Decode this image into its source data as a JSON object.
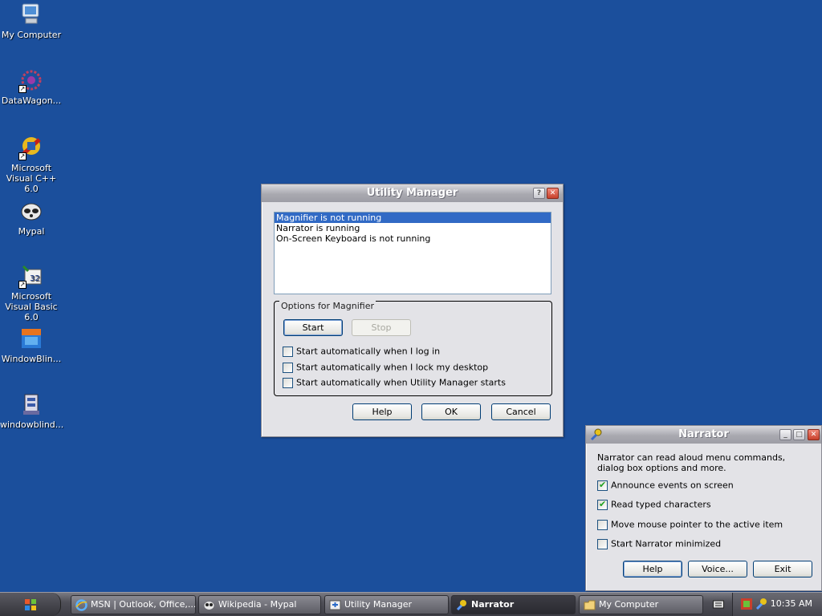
{
  "desktop": {
    "icons": [
      {
        "label": "My Computer",
        "icon": "my-computer-icon"
      },
      {
        "label": "DataWagon...",
        "icon": "datawagon-icon"
      },
      {
        "label": "Microsoft Visual C++ 6.0",
        "icon": "visual-cpp-icon"
      },
      {
        "label": "Mypal",
        "icon": "mypal-icon"
      },
      {
        "label": "Microsoft Visual Basic 6.0",
        "icon": "visual-basic-icon"
      },
      {
        "label": "WindowBlin...",
        "icon": "windowblinds-icon"
      },
      {
        "label": "windowblind...",
        "icon": "windowblinds-installer-icon"
      }
    ]
  },
  "utility_manager": {
    "title": "Utility Manager",
    "list": [
      "Magnifier is not running",
      "Narrator is running",
      "On-Screen Keyboard is not running"
    ],
    "selected_index": 0,
    "group_label": "Options for Magnifier",
    "start_label": "Start",
    "stop_label": "Stop",
    "options": [
      {
        "label": "Start automatically when I log in",
        "checked": false
      },
      {
        "label": "Start automatically when I lock my desktop",
        "checked": false
      },
      {
        "label": "Start automatically when Utility Manager starts",
        "checked": false
      }
    ],
    "help_label": "Help",
    "ok_label": "OK",
    "cancel_label": "Cancel"
  },
  "narrator": {
    "title": "Narrator",
    "description": "Narrator can read aloud menu commands, dialog box options and more.",
    "options": [
      {
        "label": "Announce events on screen",
        "checked": true
      },
      {
        "label": "Read typed characters",
        "checked": true
      },
      {
        "label": "Move mouse pointer to the active item",
        "checked": false
      },
      {
        "label": "Start Narrator minimized",
        "checked": false
      }
    ],
    "help_label": "Help",
    "voice_label": "Voice...",
    "exit_label": "Exit"
  },
  "taskbar": {
    "tasks": [
      {
        "label": "MSN | Outlook, Office,...",
        "icon": "ie-icon",
        "active": false
      },
      {
        "label": "Wikipedia - Mypal",
        "icon": "mypal-icon",
        "active": false
      },
      {
        "label": "Utility Manager",
        "icon": "utility-manager-icon",
        "active": false
      },
      {
        "label": "Narrator",
        "icon": "narrator-icon",
        "active": true
      },
      {
        "label": "My Computer",
        "icon": "folder-icon",
        "active": false
      }
    ],
    "clock": "10:35 AM"
  }
}
